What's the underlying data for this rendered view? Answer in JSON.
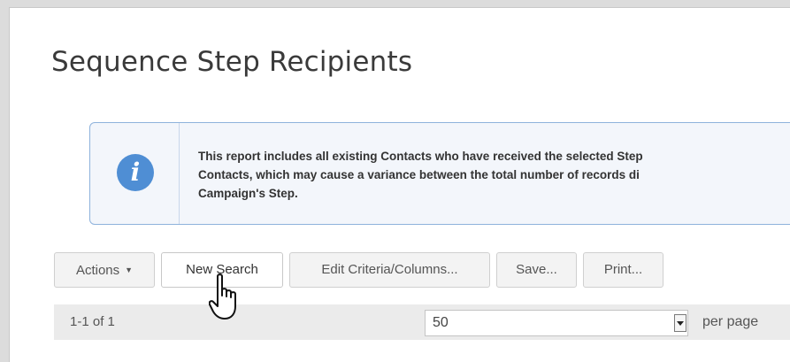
{
  "page": {
    "title": "Sequence Step Recipients"
  },
  "info": {
    "icon": "info-icon",
    "lines": [
      "This report includes all existing Contacts who have received the selected Step",
      "Contacts, which may cause a variance between the total number of records di",
      "Campaign's Step."
    ]
  },
  "toolbar": {
    "actions_label": "Actions",
    "new_search_label": "New Search",
    "edit_criteria_label": "Edit Criteria/Columns...",
    "save_label": "Save...",
    "print_label": "Print..."
  },
  "results": {
    "count_text": "1-1 of 1",
    "per_page_value": "50",
    "per_page_label": "per page"
  },
  "colors": {
    "info_accent": "#4f8ed4",
    "info_border": "#8eb2dc"
  }
}
